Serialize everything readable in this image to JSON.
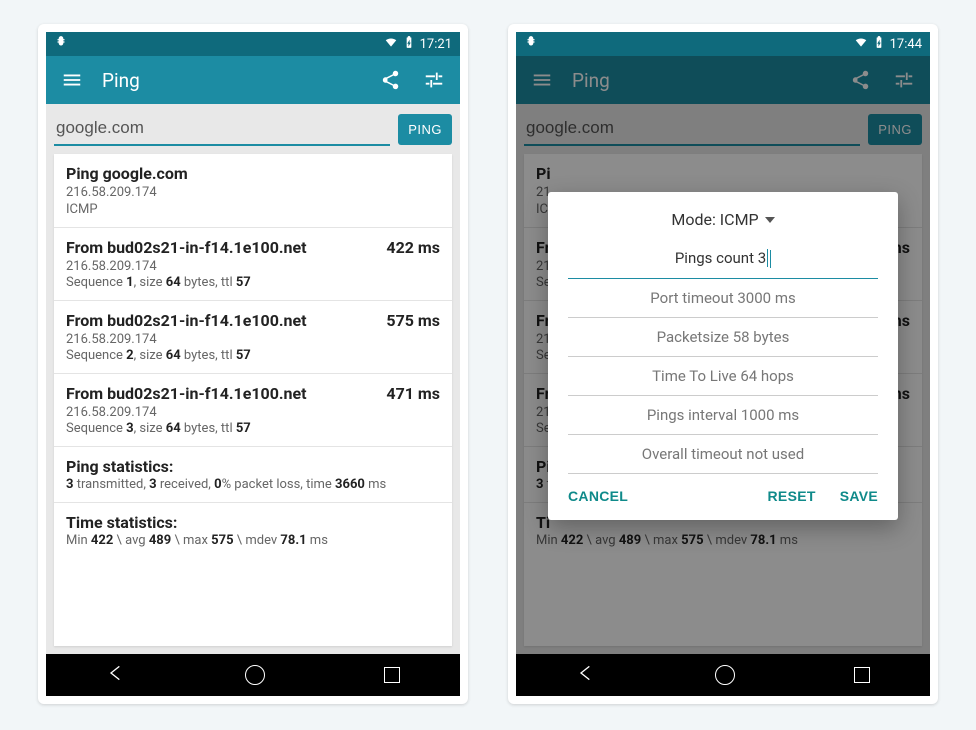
{
  "phone1": {
    "status_time": "17:21",
    "appbar_title": "Ping",
    "host_input": "google.com",
    "ping_button": "PING",
    "header": {
      "title": "Ping google.com",
      "ip": "216.58.209.174",
      "proto": "ICMP"
    },
    "replies": [
      {
        "from_prefix": "From ",
        "from": "bud02s21-in-f14.1e100.net",
        "ms": "422 ms",
        "ip": "216.58.209.174",
        "seq": "1",
        "size": "64",
        "ttl": "57"
      },
      {
        "from_prefix": "From ",
        "from": "bud02s21-in-f14.1e100.net",
        "ms": "575 ms",
        "ip": "216.58.209.174",
        "seq": "2",
        "size": "64",
        "ttl": "57"
      },
      {
        "from_prefix": "From ",
        "from": "bud02s21-in-f14.1e100.net",
        "ms": "471 ms",
        "ip": "216.58.209.174",
        "seq": "3",
        "size": "64",
        "ttl": "57"
      }
    ],
    "pingstats": {
      "title": "Ping statistics:",
      "tx": "3",
      "rx": "3",
      "loss": "0",
      "time": "3660"
    },
    "timestats": {
      "title": "Time statistics:",
      "min": "422",
      "avg": "489",
      "max": "575",
      "mdev": "78.1"
    }
  },
  "phone2": {
    "status_time": "17:44",
    "appbar_title": "Ping",
    "host_input": "google.com",
    "ping_button": "PING",
    "dialog": {
      "mode_label": "Mode: ICMP",
      "pings_count_label": "Pings count ",
      "pings_count_value": "3",
      "port_timeout": "Port timeout 3000 ms",
      "packetsize": "Packetsize 58 bytes",
      "ttl": "Time To Live 64 hops",
      "interval": "Pings interval 1000 ms",
      "overall": "Overall timeout not used",
      "cancel": "CANCEL",
      "reset": "RESET",
      "save": "SAVE"
    },
    "bg_timestats": {
      "min": "422",
      "avg": "489",
      "max": "575",
      "mdev": "78.1"
    }
  },
  "detail_labels": {
    "seq": "Sequence ",
    "size": ", size ",
    "bytes": " bytes, ttl ",
    "tx": " transmitted, ",
    "rx": " received, ",
    "loss": "% packet loss, time ",
    "ms": " ms",
    "min": "Min ",
    "avg": " \\ avg ",
    "max": " \\ max ",
    "mdev": " \\ mdev "
  }
}
